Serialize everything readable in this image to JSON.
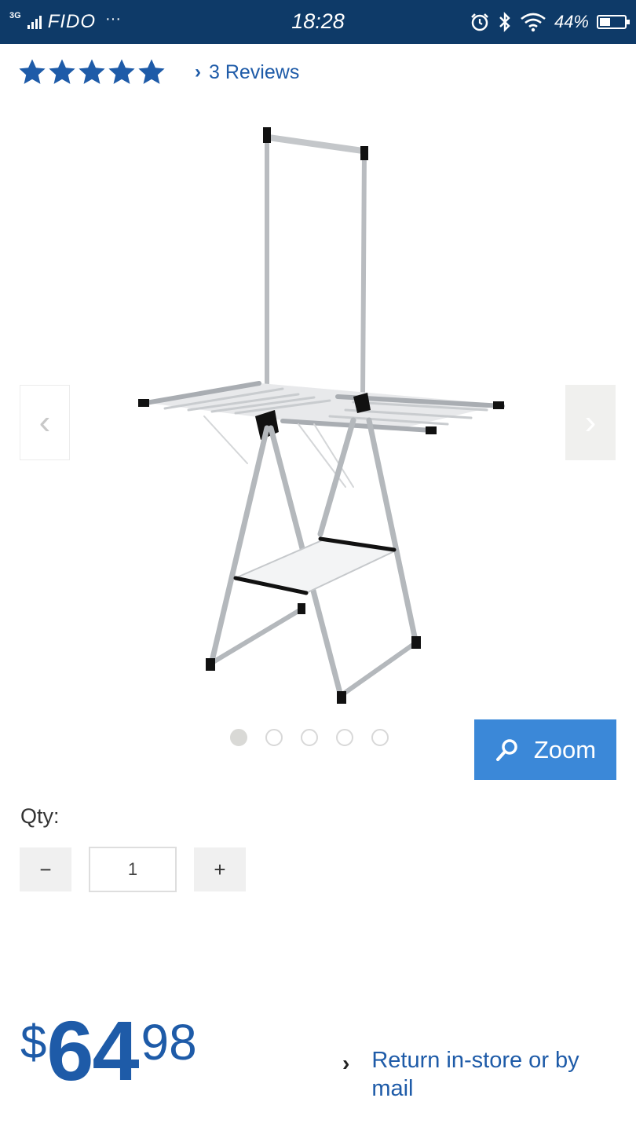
{
  "status_bar": {
    "network": "3G",
    "carrier": "FIDO",
    "more": "···",
    "time": "18:28",
    "battery_text": "44%",
    "battery_level": 0.44
  },
  "rating": {
    "stars": 5,
    "reviews_label": "3 Reviews",
    "star_color": "#1e5ba8"
  },
  "gallery": {
    "prev_arrow": "‹",
    "next_arrow": "›",
    "dot_count": 5,
    "active_dot": 0,
    "zoom_label": "Zoom"
  },
  "qty": {
    "label": "Qty:",
    "minus": "−",
    "plus": "+",
    "value": "1"
  },
  "price": {
    "currency": "$",
    "dollars": "64",
    "cents": "98"
  },
  "return_policy": {
    "label": "Return in-store or by mail"
  },
  "colors": {
    "status_bar_bg": "#0e3a68",
    "link_blue": "#1e5ba8",
    "zoom_button": "#3b88d8"
  }
}
